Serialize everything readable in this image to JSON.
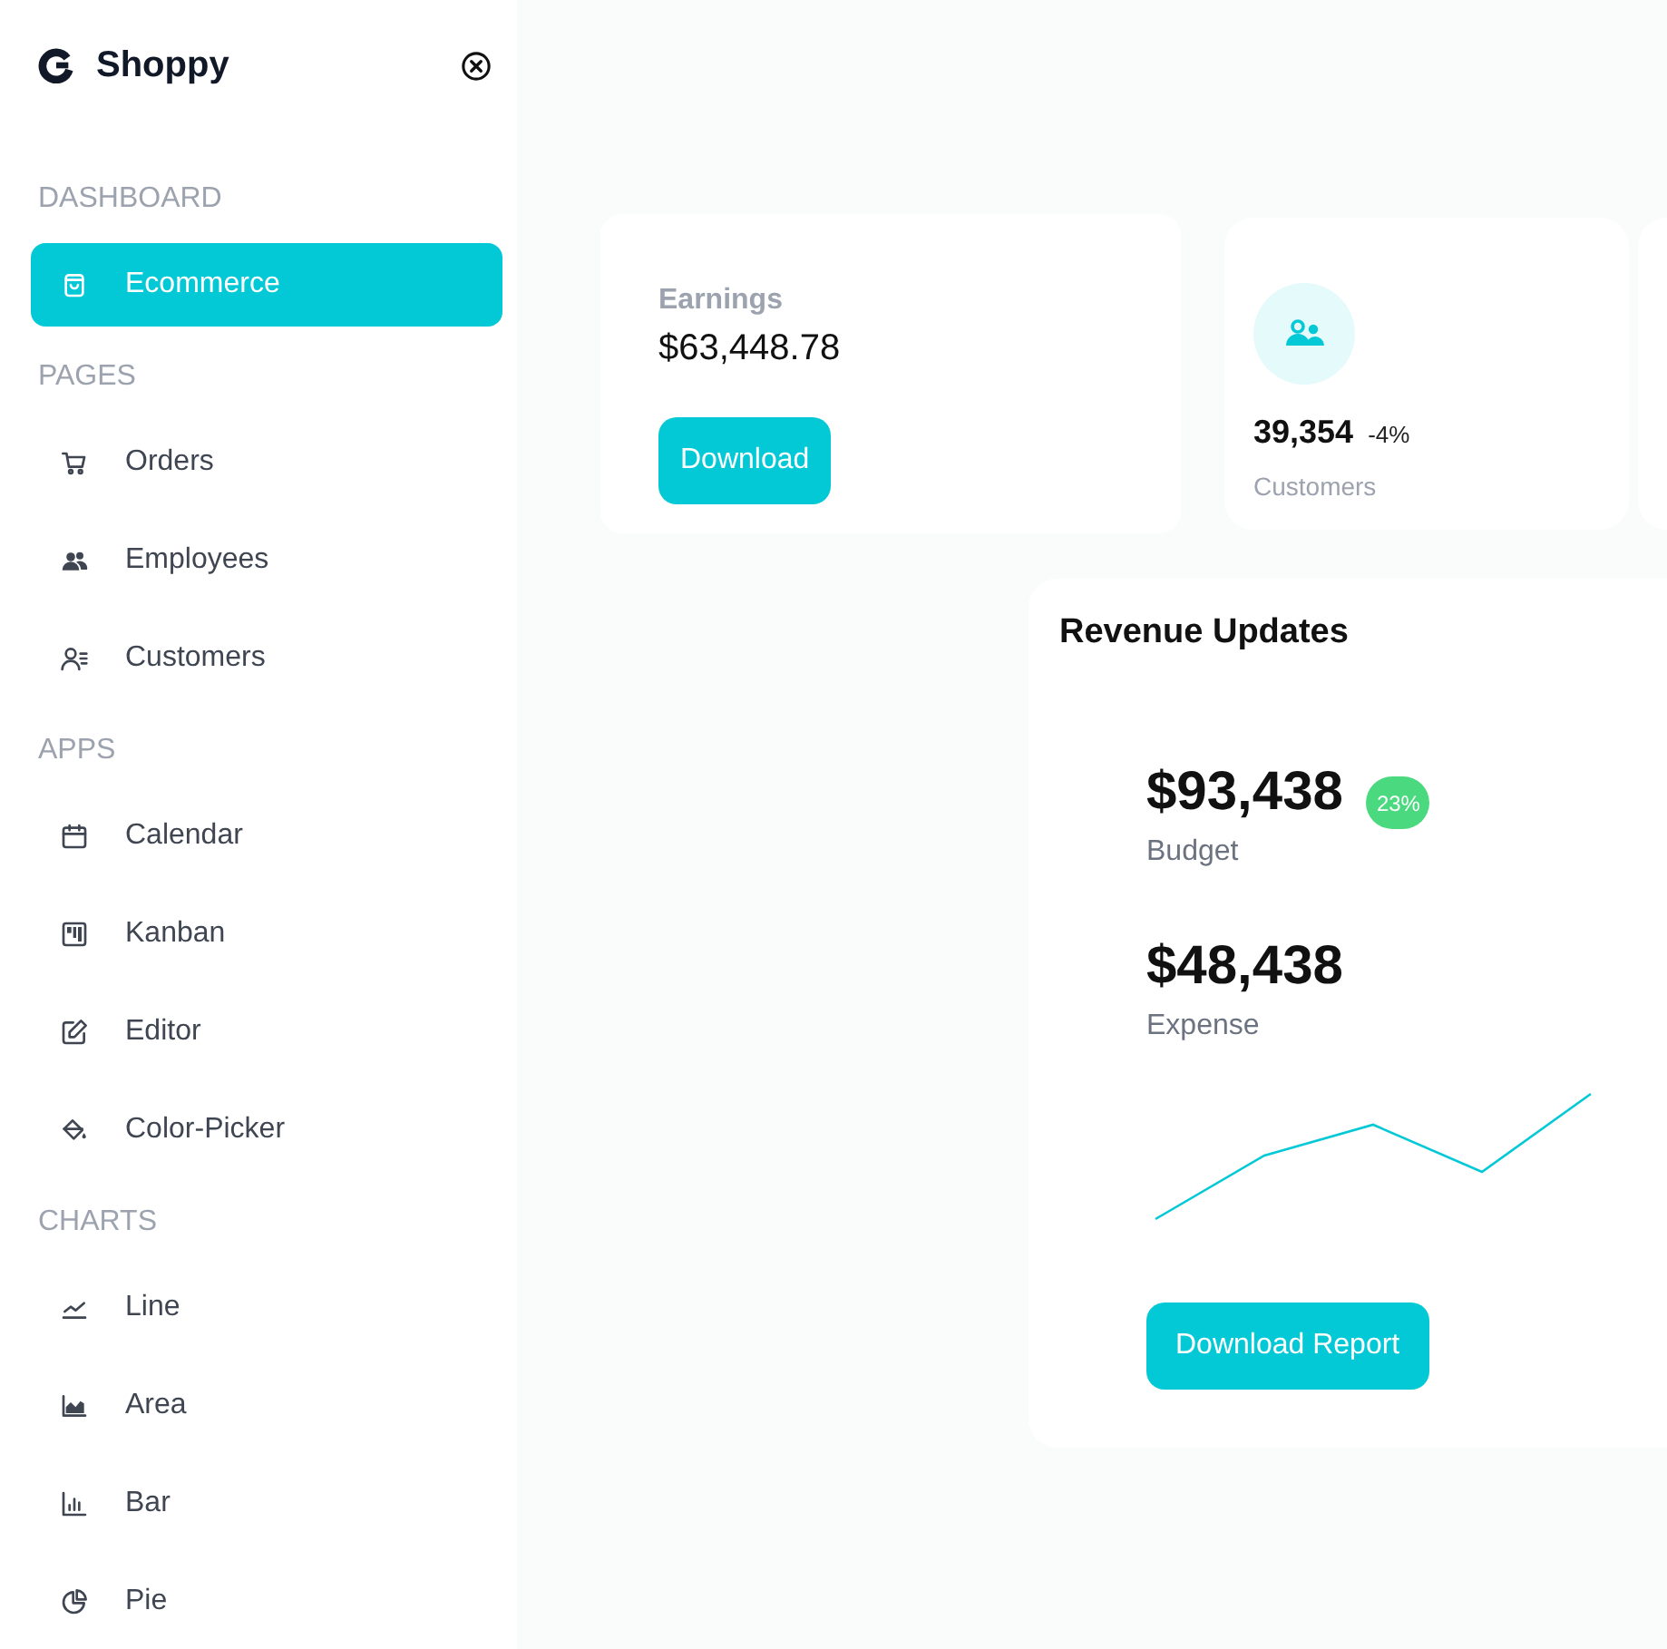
{
  "sidebar": {
    "title": "Shoppy",
    "sections": [
      {
        "heading": "DASHBOARD",
        "items": [
          {
            "label": "Ecommerce",
            "selected": true
          }
        ]
      },
      {
        "heading": "PAGES",
        "items": [
          {
            "label": "Orders",
            "selected": false
          },
          {
            "label": "Employees",
            "selected": false
          },
          {
            "label": "Customers",
            "selected": false
          }
        ]
      },
      {
        "heading": "APPS",
        "items": [
          {
            "label": "Calendar",
            "selected": false
          },
          {
            "label": "Kanban",
            "selected": false
          },
          {
            "label": "Editor",
            "selected": false
          },
          {
            "label": "Color-Picker",
            "selected": false
          }
        ]
      },
      {
        "heading": "CHARTS",
        "items": [
          {
            "label": "Line",
            "selected": false
          },
          {
            "label": "Area",
            "selected": false
          },
          {
            "label": "Bar",
            "selected": false
          },
          {
            "label": "Pie",
            "selected": false
          }
        ]
      }
    ]
  },
  "earnings": {
    "label": "Earnings",
    "amount": "$63,448.78",
    "button": "Download"
  },
  "stats": [
    {
      "amount": "39,354",
      "change": "-4%",
      "label": "Customers"
    }
  ],
  "revenue": {
    "title": "Revenue Updates",
    "figures": [
      {
        "amount": "$93,438",
        "label": "Budget",
        "badge": "23%"
      },
      {
        "amount": "$48,438",
        "label": "Expense"
      }
    ],
    "button": "Download Report"
  }
}
